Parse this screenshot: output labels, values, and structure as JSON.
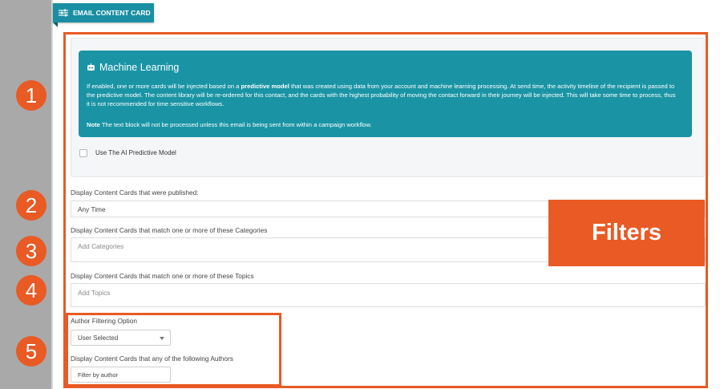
{
  "tab": {
    "title": "EMAIL CONTENT CARD"
  },
  "ml": {
    "title": "Machine Learning",
    "text_1": "If enabled, one or more cards will be injected based on a ",
    "text_bold": "predictive model",
    "text_2": " that was created using data from your account and machine learning processing. At send time, the activity timeline of the recipient is passed to the predictive model. The content library will be re-ordered for this contact, and the cards with the highest probability of moving the contact forward in their journey will be injected. This will take some time to process, thus it is not recommended for time sensitive workflows.",
    "note_label": "Note",
    "note_text": " The text block will not be processed unless this email is being sent from within a campaign workflow.",
    "checkbox_label": "Use The AI Predictive Model"
  },
  "fields": {
    "published_label": "Display Content Cards that were published:",
    "published_value": "Any Time",
    "categories_label": "Display Content Cards that match one or more of these Categories",
    "categories_placeholder": "Add Categories",
    "topics_label": "Display Content Cards that match one or more of these Topics",
    "topics_placeholder": "Add Topics",
    "author_option_label": "Author Filtering Option",
    "author_option_value": "User Selected",
    "authors_label": "Display Content Cards that any of the following Authors",
    "authors_placeholder": "Filter by author"
  },
  "annotations": {
    "badges": [
      "1",
      "2",
      "3",
      "4",
      "5"
    ],
    "callout": "Filters",
    "accent_color": "#e95a24"
  },
  "colors": {
    "tab": "#1a8fa3",
    "ml_box": "#1a94a5"
  }
}
